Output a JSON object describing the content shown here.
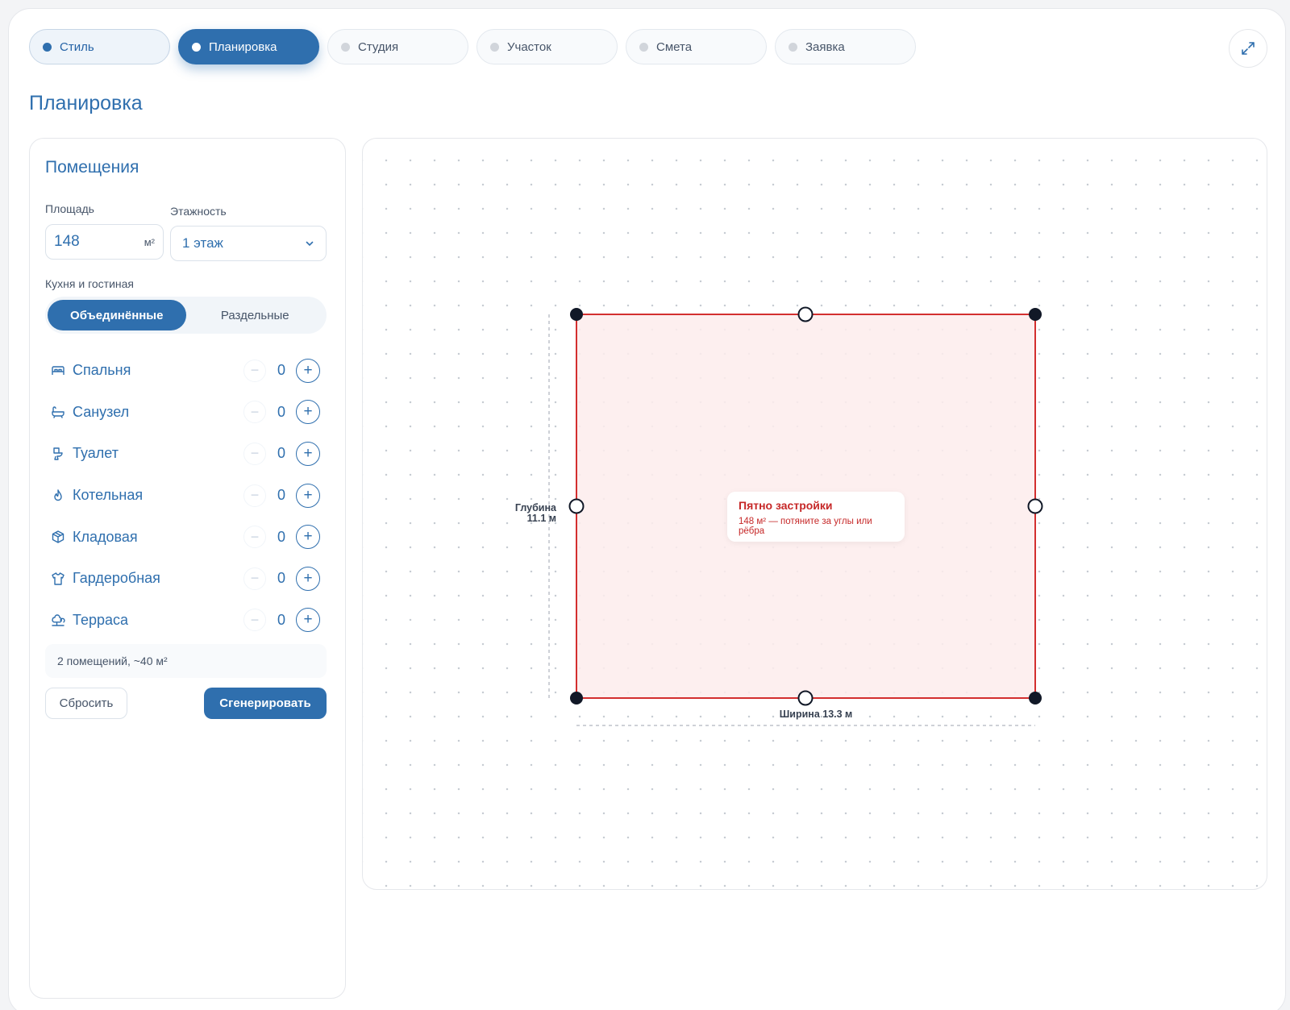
{
  "tabs": [
    {
      "label": "Стиль",
      "state": "done"
    },
    {
      "label": "Планировка",
      "state": "active"
    },
    {
      "label": "Студия",
      "state": "inactive"
    },
    {
      "label": "Участок",
      "state": "inactive"
    },
    {
      "label": "Смета",
      "state": "inactive"
    },
    {
      "label": "Заявка",
      "state": "inactive"
    }
  ],
  "expand_icon": "expand-icon",
  "page_title": "Планировка",
  "panel": {
    "title": "Помещения",
    "area_label": "Площадь",
    "area_value": "148",
    "area_unit": "м²",
    "floors_label": "Этажность",
    "floors_value": "1 этаж",
    "kitchen_label": "Кухня и гостиная",
    "kitchen_options": [
      "Объединённые",
      "Раздельные"
    ],
    "kitchen_selected": "Объединённые",
    "rooms": [
      {
        "label": "Спальня",
        "icon": "bed-icon",
        "count": "0"
      },
      {
        "label": "Санузел",
        "icon": "bathtub-icon",
        "count": "0"
      },
      {
        "label": "Туалет",
        "icon": "toilet-icon",
        "count": "0"
      },
      {
        "label": "Котельная",
        "icon": "flame-icon",
        "count": "0"
      },
      {
        "label": "Кладовая",
        "icon": "box-icon",
        "count": "0"
      },
      {
        "label": "Гардеробная",
        "icon": "shirt-icon",
        "count": "0"
      },
      {
        "label": "Терраса",
        "icon": "tree-icon",
        "count": "0"
      }
    ],
    "summary": "2 помещений, ~40 м²",
    "reset_label": "Сбросить",
    "generate_label": "Сгенерировать"
  },
  "canvas": {
    "footprint_title": "Пятно застройки",
    "footprint_hint": "148 м² — потяните за углы или рёбра",
    "depth_label": "Глубина",
    "depth_value": "11.1 м",
    "width_label": "Ширина 13.3 м",
    "footprint_stroke": "#d32f2f",
    "footprint_fill": "#fdecec"
  },
  "colors": {
    "accent": "#2f6fae",
    "danger": "#d32f2f"
  }
}
